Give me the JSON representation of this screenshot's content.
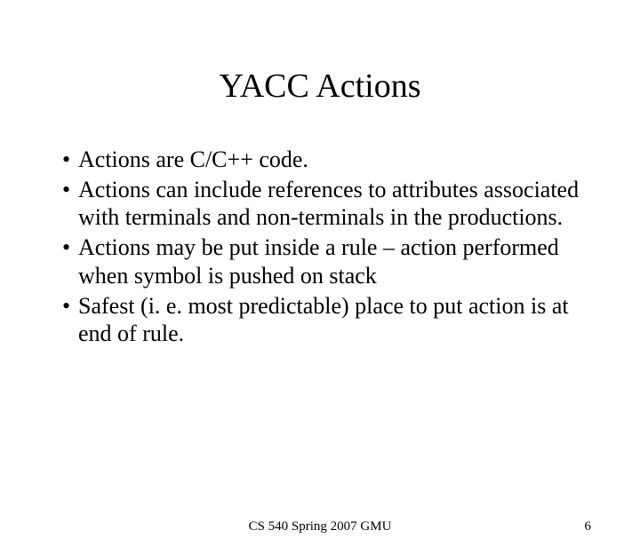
{
  "title": "YACC Actions",
  "bullets": [
    "Actions are C/C++ code.",
    "Actions can include references to attributes associated with terminals and non-terminals in the productions.",
    "Actions may be put inside a rule – action performed when symbol is pushed on stack",
    "Safest (i. e. most predictable) place to put action is at end of rule."
  ],
  "footer": {
    "center": "CS 540 Spring 2007 GMU",
    "page": "6"
  }
}
